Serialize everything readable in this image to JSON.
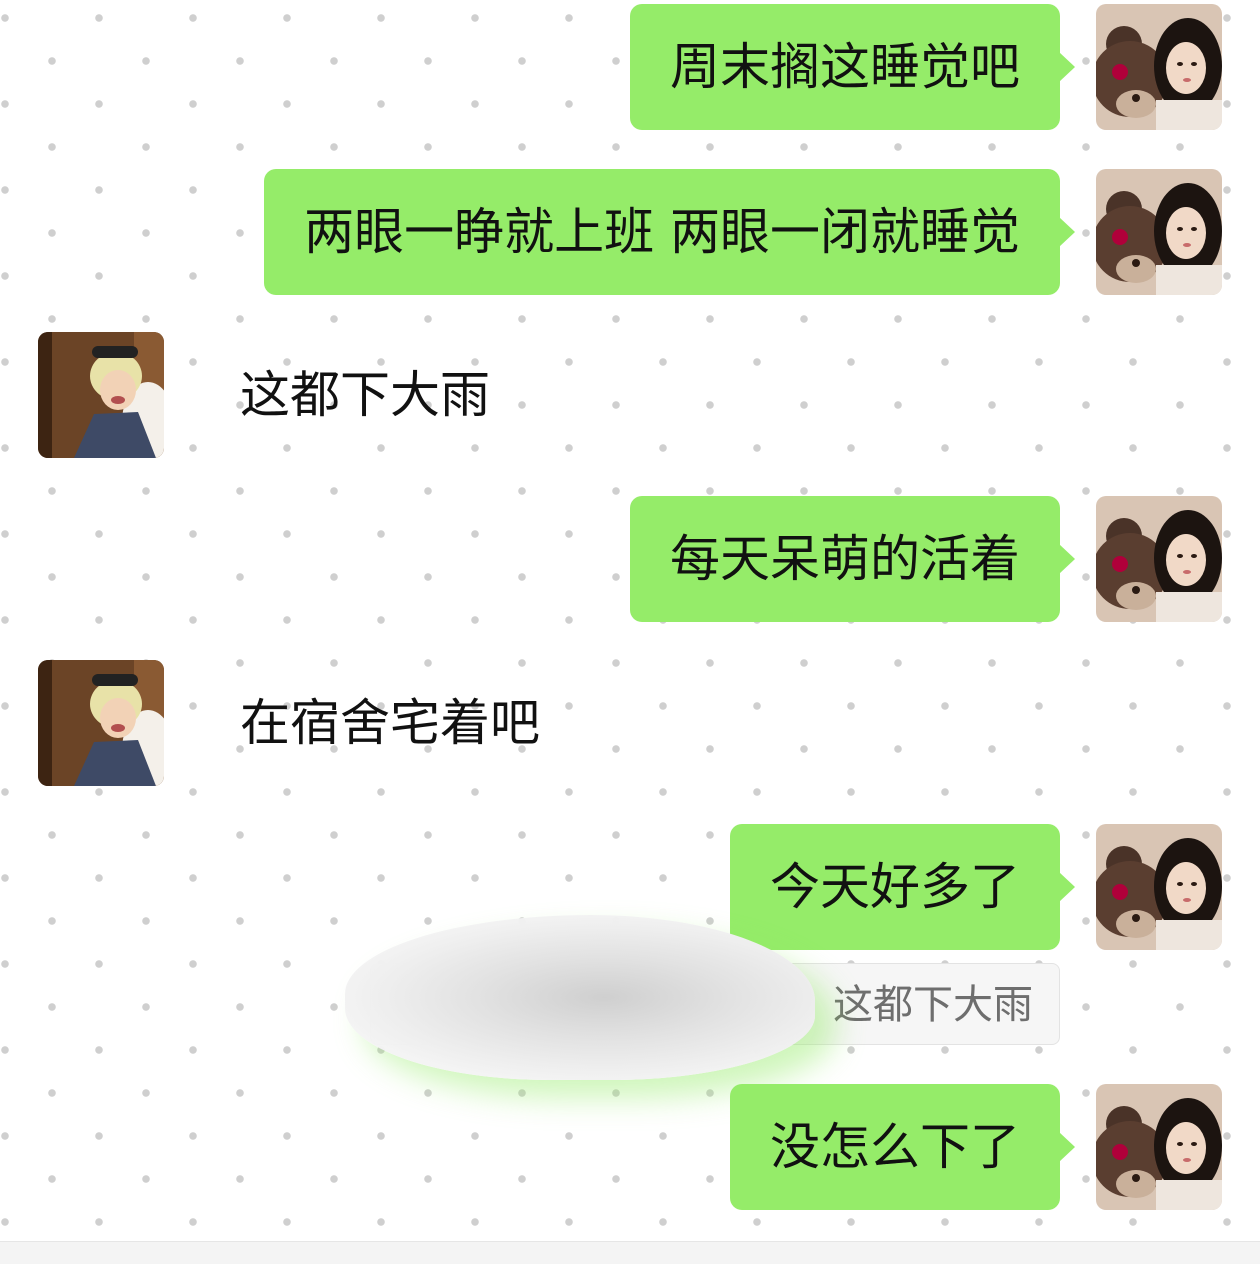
{
  "messages": [
    {
      "sender": "me",
      "text": "周末搁这睡觉吧"
    },
    {
      "sender": "me",
      "text": "两眼一睁就上班 两眼一闭就睡觉"
    },
    {
      "sender": "other",
      "text": "这都下大雨"
    },
    {
      "sender": "me",
      "text": "每天呆萌的活着"
    },
    {
      "sender": "other",
      "text": "在宿舍宅着吧"
    },
    {
      "sender": "me",
      "text": "今天好多了"
    },
    {
      "sender": "me",
      "text": "没怎么下了"
    }
  ],
  "quote": {
    "text": "这都下大雨"
  },
  "colors": {
    "my_bubble": "#95ec69",
    "background": "#ffffff",
    "dot": "#cfcfcf"
  }
}
